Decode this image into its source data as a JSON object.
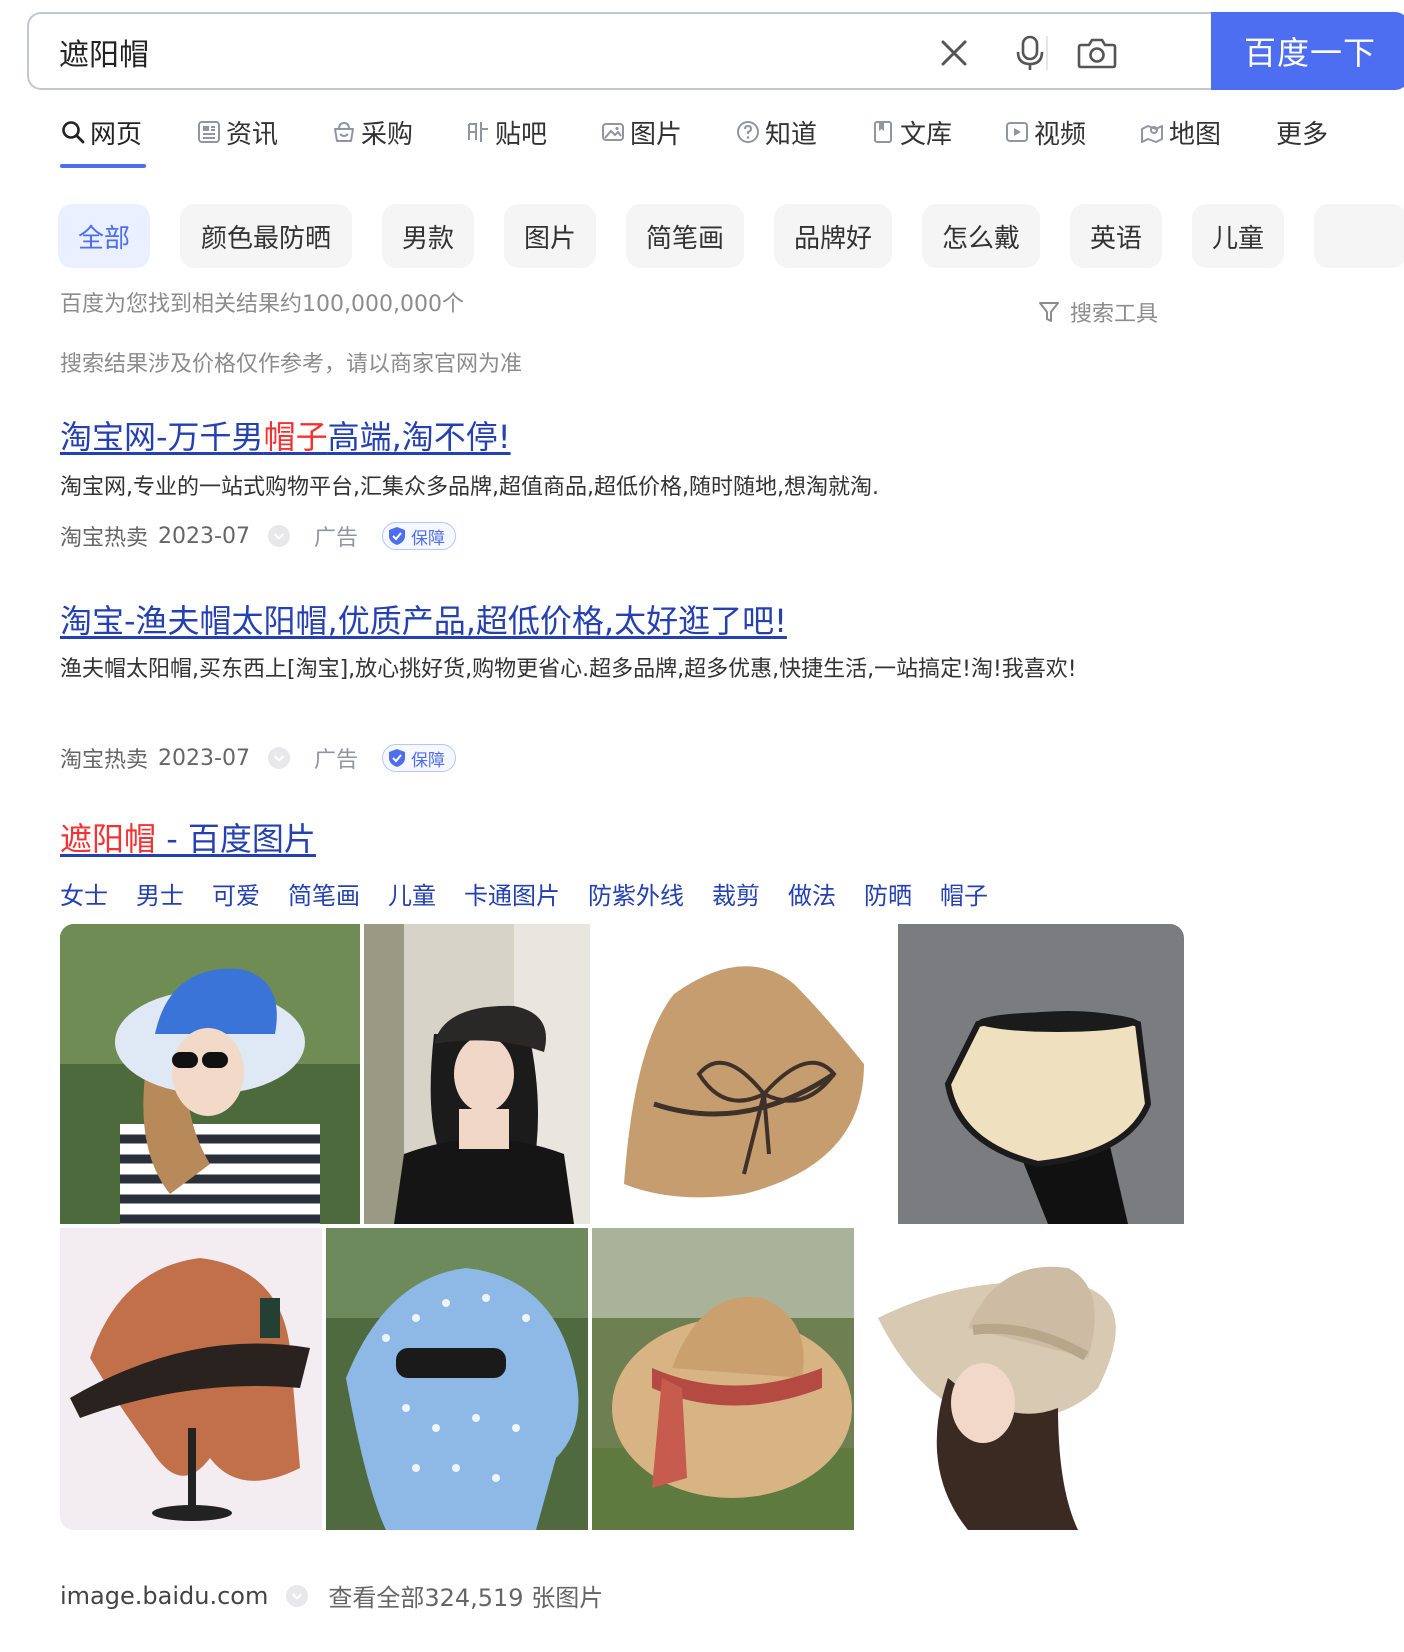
{
  "search": {
    "query": "遮阳帽",
    "button_label": "百度一下"
  },
  "tabs": [
    {
      "label": "网页",
      "icon": "search-icon"
    },
    {
      "label": "资讯",
      "icon": "news-icon"
    },
    {
      "label": "采购",
      "icon": "basket-icon"
    },
    {
      "label": "贴吧",
      "icon": "tieba-icon"
    },
    {
      "label": "图片",
      "icon": "image-icon"
    },
    {
      "label": "知道",
      "icon": "question-icon"
    },
    {
      "label": "文库",
      "icon": "document-icon"
    },
    {
      "label": "视频",
      "icon": "video-icon"
    },
    {
      "label": "地图",
      "icon": "map-icon"
    },
    {
      "label": "更多"
    }
  ],
  "chips": [
    "全部",
    "颜色最防晒",
    "男款",
    "图片",
    "简笔画",
    "品牌好",
    "怎么戴",
    "英语",
    "儿童"
  ],
  "result_count": "百度为您找到相关结果约100,000,000个",
  "tools_label": "搜索工具",
  "price_notice": "搜索结果涉及价格仅作参考，请以商家官网为准",
  "results": [
    {
      "title_pre": "淘宝网-万千男",
      "title_hl": "帽子",
      "title_post": "高端,淘不停!",
      "desc": "淘宝网,专业的一站式购物平台,汇集众多品牌,超值商品,超低价格,随时随地,想淘就淘.",
      "source": "淘宝热卖",
      "date": "2023-07",
      "ad": "广告",
      "badge": "保障"
    },
    {
      "title": "淘宝-渔夫帽太阳帽,优质产品,超低价格,太好逛了吧!",
      "desc": "渔夫帽太阳帽,买东西上[淘宝],放心挑好货,购物更省心.超多品牌,超多优惠,快捷生活,一站搞定!淘!我喜欢!",
      "source": "淘宝热卖",
      "date": "2023-07",
      "ad": "广告",
      "badge": "保障"
    }
  ],
  "image_result": {
    "title_hl": "遮阳帽",
    "title_post": " - 百度图片",
    "sublinks": [
      "女士",
      "男士",
      "可爱",
      "简笔画",
      "儿童",
      "卡通图片",
      "防紫外线",
      "裁剪",
      "做法",
      "防晒",
      "帽子"
    ],
    "site": "image.baidu.com",
    "view_all": "查看全部324,519 张图片"
  },
  "colors": {
    "accent": "#4e6ef2",
    "link": "#2440b3",
    "highlight": "#f73131"
  }
}
